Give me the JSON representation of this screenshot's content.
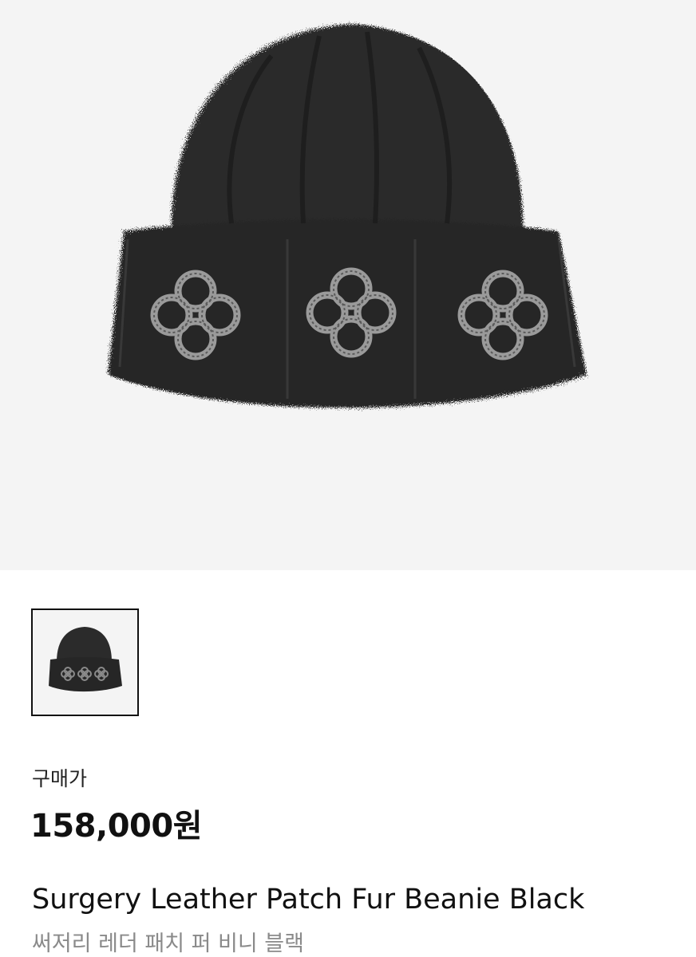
{
  "product": {
    "image_icon": "fur-beanie-image",
    "thumbnail_icon": "fur-beanie-thumbnail",
    "price_label": "구매가",
    "price": "158,000원",
    "name_en": "Surgery Leather Patch Fur Beanie Black",
    "name_ko": "써저리 레더 패치 퍼 비니 블랙"
  },
  "colors": {
    "hero_background": "#f4f4f4",
    "beanie": "#2a2a2a",
    "patch": "#8c8c8c",
    "secondary_text": "#8a8a8a"
  }
}
